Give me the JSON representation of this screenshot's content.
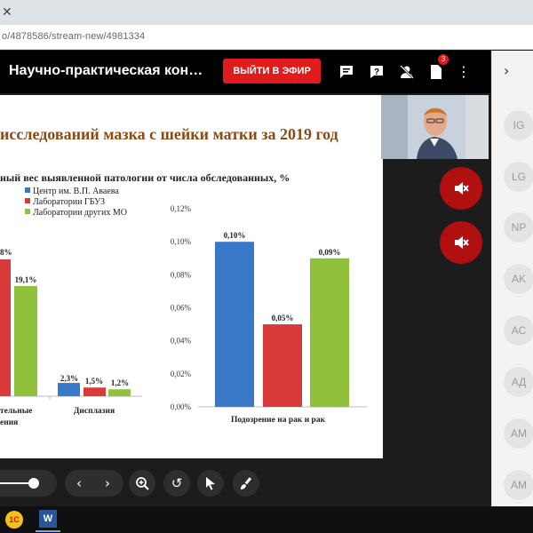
{
  "browser": {
    "url": "o/4878586/stream-new/4981334"
  },
  "app": {
    "title": "Научно-практическая кон…",
    "go_live_label": "ВЫЙТИ В ЭФИР",
    "notification_count": "3"
  },
  "slide": {
    "title": "исследований мазка с шейки матки за 2019 год",
    "subtitle": "ный вес выявленной патологии от числа обследованных, %"
  },
  "colors": {
    "series1": "#3a78c8",
    "series2": "#d83a3a",
    "series3": "#8fc23a",
    "accent": "#e01b1b"
  },
  "chart_data": [
    {
      "type": "bar",
      "categories": [
        "тельные ения",
        "Дисплазия"
      ],
      "series": [
        {
          "name": "Центр им. В.П. Аваева",
          "values": [
            null,
            2.3
          ]
        },
        {
          "name": "Лаборатории ГБУЗ",
          "values": [
            null,
            1.5
          ]
        },
        {
          "name": "Лаборатории других МО",
          "values": [
            19.1,
            1.2
          ]
        }
      ],
      "data_labels": [
        [
          "",
          "8%",
          "19,1%"
        ],
        [
          "2,3%",
          "1,5%",
          "1,2%"
        ]
      ]
    },
    {
      "type": "bar",
      "categories": [
        "Подозрение на рак и рак"
      ],
      "series": [
        {
          "name": "Центр им. В.П. Аваева",
          "values": [
            0.1
          ]
        },
        {
          "name": "Лаборатории ГБУЗ",
          "values": [
            0.05
          ]
        },
        {
          "name": "Лаборатории других МО",
          "values": [
            0.09
          ]
        }
      ],
      "data_labels": [
        [
          "0,10%",
          "0,05%",
          "0,09%"
        ]
      ],
      "yticks": [
        "0,00%",
        "0,02%",
        "0,04%",
        "0,06%",
        "0,08%",
        "0,10%",
        "0,12%"
      ],
      "ylim": [
        0,
        0.12
      ]
    }
  ],
  "toolbar": {
    "zoom_progress": 0.7
  },
  "participants": [
    "IG",
    "LG",
    "NP",
    "AK",
    "AC",
    "АД",
    "AM",
    "AM"
  ],
  "taskbar": {
    "app1": "1С",
    "app2": "W"
  }
}
